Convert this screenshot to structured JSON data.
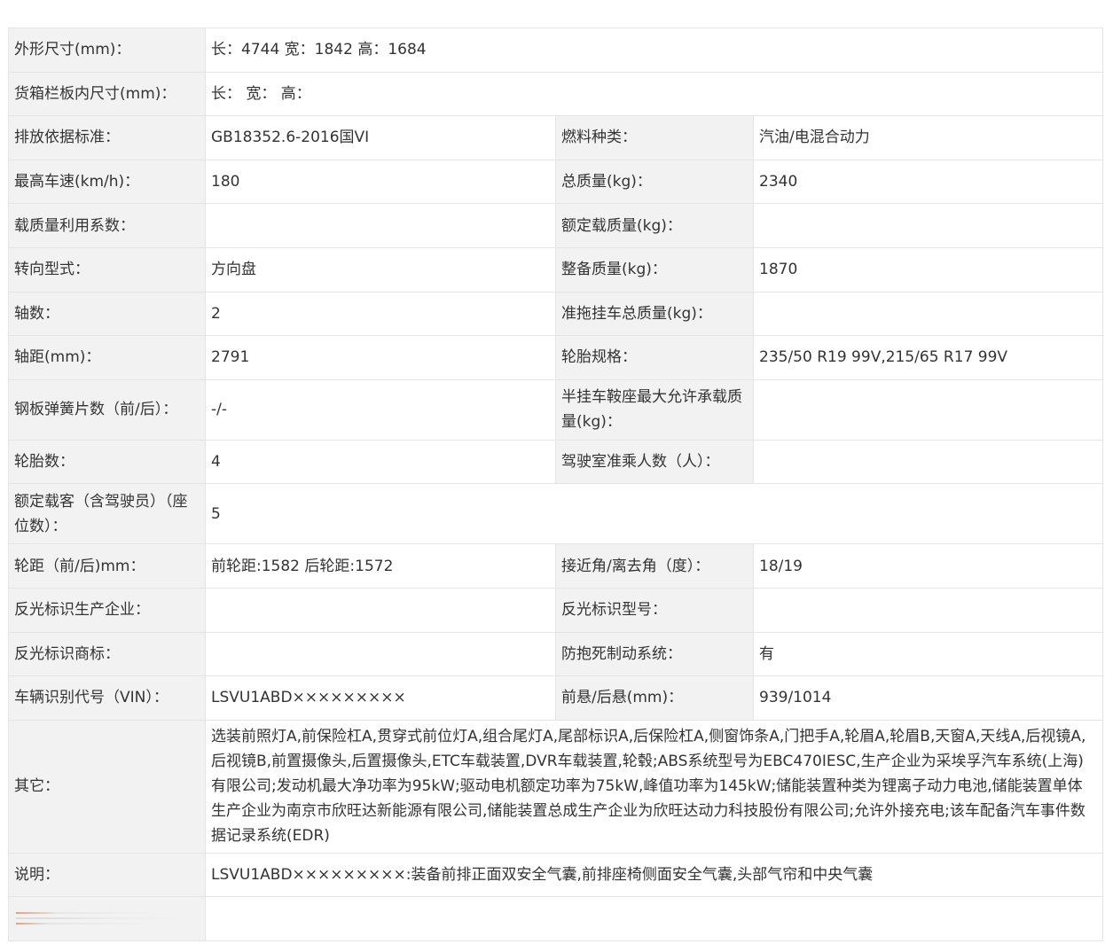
{
  "dimensions": {
    "label": "外形尺寸(mm)：",
    "value": "长：4744 宽：1842 高：1684"
  },
  "cargo_box": {
    "label": "货箱栏板内尺寸(mm)：",
    "value": "长： 宽： 高："
  },
  "rows": [
    {
      "k1": "排放依据标准：",
      "v1": "GB18352.6-2016国VI",
      "k2": "燃料种类：",
      "v2": "汽油/电混合动力"
    },
    {
      "k1": "最高车速(km/h)：",
      "v1": "180",
      "k2": "总质量(kg)：",
      "v2": "2340"
    },
    {
      "k1": "载质量利用系数：",
      "v1": "",
      "k2": "额定载质量(kg)：",
      "v2": ""
    },
    {
      "k1": "转向型式：",
      "v1": "方向盘",
      "k2": "整备质量(kg)：",
      "v2": "1870"
    },
    {
      "k1": "轴数：",
      "v1": "2",
      "k2": "准拖挂车总质量(kg)：",
      "v2": ""
    },
    {
      "k1": "轴距(mm)：",
      "v1": "2791",
      "k2": "轮胎规格：",
      "v2": "235/50 R19 99V,215/65 R17 99V"
    },
    {
      "k1": "钢板弹簧片数（前/后）：",
      "v1": "-/-",
      "k2": "半挂车鞍座最大允许承载质量(kg)：",
      "v2": ""
    },
    {
      "k1": "轮胎数：",
      "v1": "4",
      "k2": "驾驶室准乘人数（人）：",
      "v2": ""
    }
  ],
  "passengers": {
    "label": "额定载客（含驾驶员）（座位数）：",
    "value": "5"
  },
  "rows2": [
    {
      "k1": "轮距（前/后)mm：",
      "v1": "前轮距:1582 后轮距:1572",
      "k2": "接近角/离去角（度）：",
      "v2": "18/19"
    },
    {
      "k1": "反光标识生产企业：",
      "v1": "",
      "k2": "反光标识型号：",
      "v2": ""
    },
    {
      "k1": "反光标识商标：",
      "v1": "",
      "k2": "防抱死制动系统：",
      "v2": "有"
    },
    {
      "k1": "车辆识别代号（VIN）：",
      "v1": "LSVU1ABD×××××××××",
      "k2": "前悬/后悬(mm)：",
      "v2": "939/1014"
    }
  ],
  "other": {
    "label": "其它：",
    "value": "选装前照灯A,前保险杠A,贯穿式前位灯A,组合尾灯A,尾部标识A,后保险杠A,侧窗饰条A,门把手A,轮眉A,轮眉B,天窗A,天线A,后视镜A,后视镜B,前置摄像头,后置摄像头,ETC车载装置,DVR车载装置,轮毂;ABS系统型号为EBC470IESC,生产企业为采埃孚汽车系统(上海)有限公司;发动机最大净功率为95kW;驱动电机额定功率为75kW,峰值功率为145kW;储能装置种类为锂离子动力电池,储能装置单体生产企业为南京市欣旺达新能源有限公司,储能装置总成生产企业为欣旺达动力科技股份有限公司;允许外接充电;该车配备汽车事件数据记录系统(EDR)"
  },
  "note": {
    "label": "说明：",
    "value": "LSVU1ABD×××××××××:装备前排正面双安全气囊,前排座椅侧面安全气囊,头部气帘和中央气囊"
  },
  "colors": {
    "label_bg": "#f2f2f2",
    "value_bg": "#ffffff",
    "border": "#e4e4e4",
    "text": "#333333",
    "stamp_accent": "#e8a080"
  }
}
